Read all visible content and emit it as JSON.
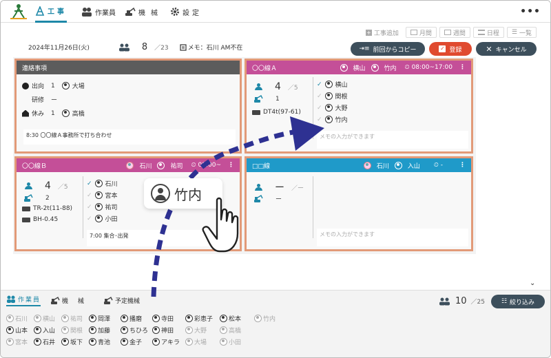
{
  "nav": {
    "tabs": [
      {
        "label": "工事",
        "icon": "construction-cone-icon"
      },
      {
        "label": "作業員",
        "icon": "workers-icon"
      },
      {
        "label": "機械",
        "icon": "excavator-icon"
      },
      {
        "label": "設定",
        "icon": "gear-icon"
      }
    ],
    "more": "•••"
  },
  "toolbar": {
    "add_work": "工事追加",
    "views": [
      "月間",
      "週間",
      "日程",
      "一覧"
    ]
  },
  "info": {
    "date": "2024年11月26日(火)",
    "count": "8",
    "total": "／23",
    "memo": "メモ：石川 AM不在"
  },
  "actions": {
    "copy": "前回からコピー",
    "save": "登録",
    "cancel": "キャンセル"
  },
  "colors": {
    "accent": "#1e88a8",
    "pink": "#c44f98",
    "blue": "#1f9ac9",
    "grey_head": "#5c5c5c",
    "card_border": "#e29a78",
    "save": "#e04a2f",
    "dark_btn": "#3d4f5c"
  },
  "notice": {
    "title": "連絡事項",
    "lines": [
      {
        "label": "出向",
        "count": "1",
        "names": "大場"
      },
      {
        "label": "研修",
        "count": "ー",
        "names": ""
      },
      {
        "label": "休み",
        "count": "1",
        "names": "高橋"
      }
    ],
    "memo": "8:30 〇〇線Ａ事務所で打ち合わせ"
  },
  "cards": [
    {
      "title": "〇〇線Ａ",
      "staff": [
        "横山",
        "竹内"
      ],
      "time": "08:00~17:00",
      "workers": "4",
      "workers_total": "／5",
      "machines": "1",
      "machine_list": [
        "DT4t(97-61)"
      ],
      "names": [
        {
          "name": "横山",
          "checked": true,
          "dim": false
        },
        {
          "name": "関根",
          "checked": true,
          "dim": true
        },
        {
          "name": "大野",
          "checked": true,
          "dim": true
        },
        {
          "name": "竹内",
          "checked": true,
          "dim": true
        }
      ],
      "memo": "メモの入力ができます"
    },
    {
      "title": "〇〇線Ｂ",
      "staff": [
        "石川",
        "祐司"
      ],
      "time": "08:00~",
      "workers": "4",
      "workers_total": "／5",
      "machines": "2",
      "machine_list": [
        "TR-2t(11-88)",
        "BH-0.45"
      ],
      "names": [
        {
          "name": "石川",
          "checked": true,
          "dim": false
        },
        {
          "name": "宮本",
          "checked": true,
          "dim": true
        },
        {
          "name": "祐司",
          "checked": true,
          "dim": true
        },
        {
          "name": "小田",
          "checked": true,
          "dim": true
        }
      ],
      "memo": "7:00 集合･出発"
    },
    {
      "title": "□□線",
      "staff": [
        "石川",
        "入山"
      ],
      "time": "-",
      "workers": "ー",
      "workers_total": "／ー",
      "machines": "ー",
      "machine_list": [],
      "names": [],
      "memo": "メモの入力ができます"
    }
  ],
  "drag": {
    "name": "竹内"
  },
  "bottom": {
    "tabs": [
      "作業員",
      "機械",
      "予定機械"
    ],
    "count": "10",
    "total": "／25",
    "filter": "絞り込み",
    "employees": [
      {
        "name": "石川",
        "dim": true
      },
      {
        "name": "横山",
        "dim": true
      },
      {
        "name": "祐司",
        "dim": true
      },
      {
        "name": "岡澤",
        "dim": false
      },
      {
        "name": "播磨",
        "dim": false
      },
      {
        "name": "寺田",
        "dim": false
      },
      {
        "name": "彩恵子",
        "dim": false
      },
      {
        "name": "松本",
        "dim": false
      },
      {
        "name": "竹内",
        "dim": true
      },
      {
        "name": "山本",
        "dim": false
      },
      {
        "name": "入山",
        "dim": false
      },
      {
        "name": "関根",
        "dim": true
      },
      {
        "name": "加藤",
        "dim": false
      },
      {
        "name": "ちひろ",
        "dim": false
      },
      {
        "name": "神田",
        "dim": false
      },
      {
        "name": "大野",
        "dim": true
      },
      {
        "name": "高橋",
        "dim": true
      },
      {
        "name": "",
        "dim": true
      },
      {
        "name": "宮本",
        "dim": true
      },
      {
        "name": "石井",
        "dim": false
      },
      {
        "name": "坂下",
        "dim": false
      },
      {
        "name": "青池",
        "dim": false
      },
      {
        "name": "金子",
        "dim": false
      },
      {
        "name": "アキラ",
        "dim": false
      },
      {
        "name": "大場",
        "dim": true
      },
      {
        "name": "小田",
        "dim": true
      },
      {
        "name": "",
        "dim": true
      }
    ]
  }
}
